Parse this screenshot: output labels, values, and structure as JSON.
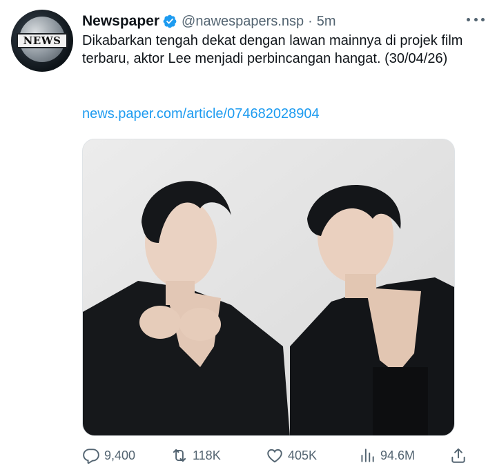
{
  "account": {
    "avatar_text": "NEWS",
    "name": "Newspaper",
    "handle": "@nawespapers.nsp",
    "separator": "·",
    "time": "5m"
  },
  "tweet": {
    "text": "Dikabarkan tengah dekat dengan lawan mainnya di projek film terbaru, aktor Lee menjadi perbincangan hangat. (30/04/26)",
    "link": "news.paper.com/article/074682028904"
  },
  "actions": {
    "replies": "9,400",
    "retweets": "118K",
    "likes": "405K",
    "views": "94.6M"
  },
  "colors": {
    "link": "#1d9bf0",
    "verified": "#1d9bf0",
    "muted": "#536471"
  },
  "icons": [
    "verified-badge-icon",
    "more-options-icon",
    "reply-icon",
    "retweet-icon",
    "like-icon",
    "views-icon",
    "share-icon"
  ]
}
